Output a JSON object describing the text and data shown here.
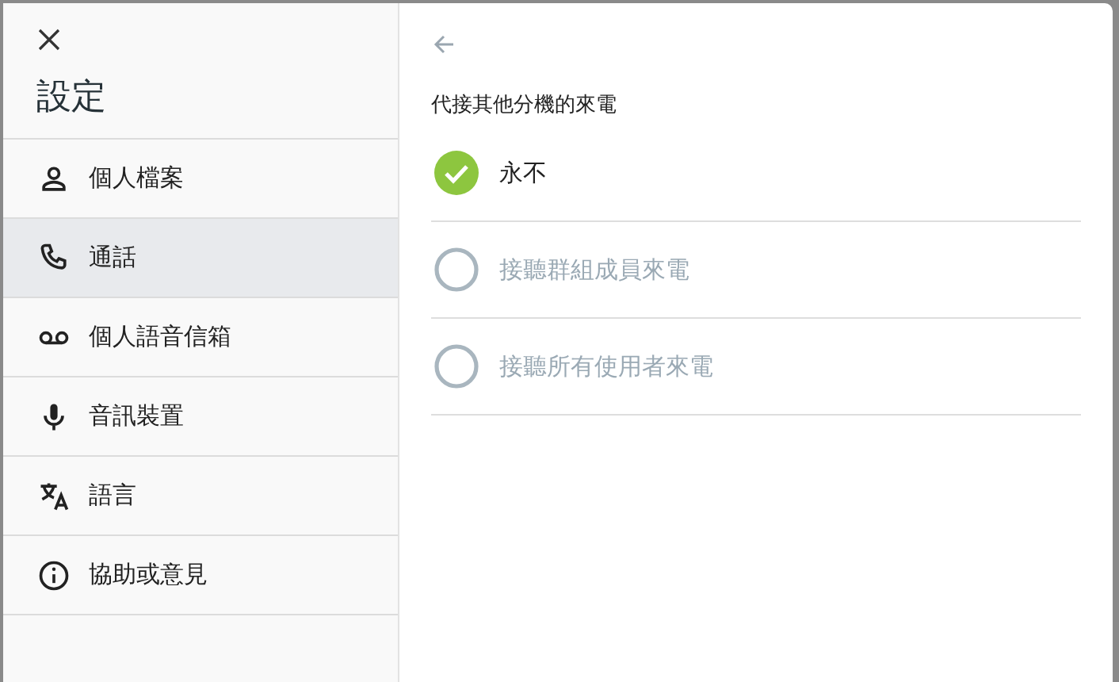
{
  "sidebar": {
    "title": "設定",
    "items": [
      {
        "label": "個人檔案",
        "selected": false
      },
      {
        "label": "通話",
        "selected": true
      },
      {
        "label": "個人語音信箱",
        "selected": false
      },
      {
        "label": "音訊裝置",
        "selected": false
      },
      {
        "label": "語言",
        "selected": false
      },
      {
        "label": "協助或意見",
        "selected": false
      }
    ]
  },
  "panel": {
    "heading": "代接其他分機的來電",
    "options": [
      {
        "label": "永不",
        "selected": true
      },
      {
        "label": "接聽群組成員來電",
        "selected": false
      },
      {
        "label": "接聽所有使用者來電",
        "selected": false
      }
    ]
  }
}
